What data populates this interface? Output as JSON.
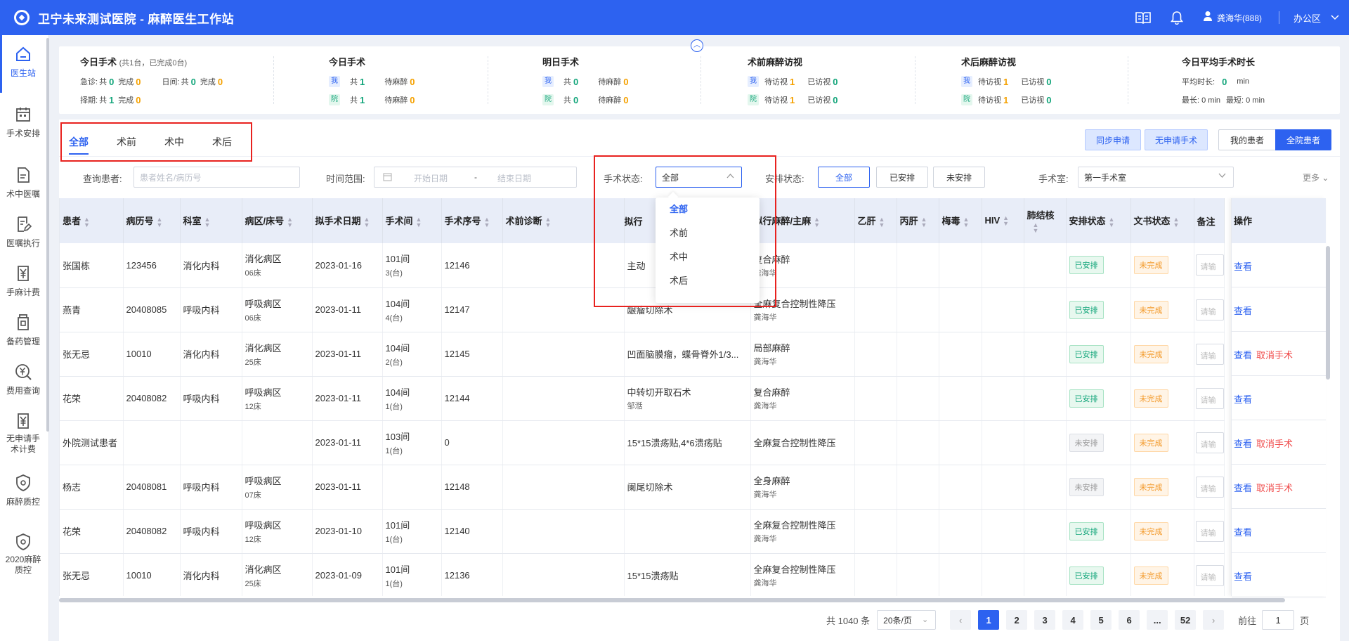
{
  "app": {
    "title": "卫宁未来测试医院 - 麻醉医生工作站"
  },
  "topbar": {
    "user": "龚海华(888)",
    "office": "办公区",
    "icons": [
      "book-icon",
      "bell-icon",
      "user-icon"
    ]
  },
  "sidebar": {
    "items": [
      {
        "label": "医生站",
        "icon": "home-icon",
        "glyph": "⌂"
      },
      {
        "label": "手术安排",
        "icon": "calendar-icon",
        "glyph": "▦"
      },
      {
        "label": "术中医嘱",
        "icon": "document-icon",
        "glyph": "▤"
      },
      {
        "label": "医嘱执行",
        "icon": "edit-document-icon",
        "glyph": "✎"
      },
      {
        "label": "手麻计费",
        "icon": "yen-icon",
        "glyph": "¥"
      },
      {
        "label": "备药管理",
        "icon": "medicine-icon",
        "glyph": "⚱"
      },
      {
        "label": "费用查询",
        "icon": "yen-search-icon",
        "glyph": "¥"
      },
      {
        "label": "无申请手术计费",
        "icon": "yen-document-icon",
        "glyph": "¥"
      },
      {
        "label": "麻醉质控",
        "icon": "shield-icon",
        "glyph": "⛉"
      },
      {
        "label": "2020麻醉质控",
        "icon": "shield-icon",
        "glyph": "⛉"
      }
    ]
  },
  "stats": {
    "today_surgery": {
      "title": "今日手术",
      "sub": "(共1台，已完成0台)",
      "emergency_label": "急诊:",
      "total_label": "共",
      "done_label": "完成",
      "emergency_total": "0",
      "emergency_done": "0",
      "day_label": "日间:",
      "day_total": "0",
      "day_done": "0",
      "elective_label": "择期:",
      "elective_total": "1",
      "elective_done": "0"
    },
    "today_op": {
      "title": "今日手术",
      "me": "我",
      "yuan": "院",
      "total_label": "共",
      "pending_label": "待麻醉",
      "me_total": "1",
      "me_pending": "0",
      "yuan_total": "1",
      "yuan_pending": "0"
    },
    "tomorrow_op": {
      "title": "明日手术",
      "me": "我",
      "yuan": "院",
      "total_label": "共",
      "pending_label": "待麻醉",
      "me_total": "0",
      "me_pending": "0",
      "yuan_total": "0",
      "yuan_pending": "0"
    },
    "pre_visit": {
      "title": "术前麻醉访视",
      "me": "我",
      "yuan": "院",
      "pending_label": "待访视",
      "done_label": "已访视",
      "me_pending": "1",
      "me_done": "0",
      "yuan_pending": "1",
      "yuan_done": "0"
    },
    "post_visit": {
      "title": "术后麻醉访视",
      "me": "我",
      "yuan": "院",
      "pending_label": "待访视",
      "done_label": "已访视",
      "me_pending": "1",
      "me_done": "0",
      "yuan_pending": "1",
      "yuan_done": "0"
    },
    "avg_duration": {
      "title": "今日平均手术时长",
      "avg_label": "平均时长:",
      "avg_value": "0",
      "unit": "min",
      "max_label": "最长: 0 min",
      "min_label": "最短: 0 min"
    }
  },
  "tabs": [
    "全部",
    "术前",
    "术中",
    "术后"
  ],
  "buttons": {
    "sync": "同步申请",
    "no_apply": "无申请手术",
    "my_patients": "我的患者",
    "all_patients": "全院患者"
  },
  "filters": {
    "query_label": "查询患者:",
    "query_placeholder": "患者姓名/病历号",
    "time_label": "时间范围:",
    "start_placeholder": "开始日期",
    "range_sep": "-",
    "end_placeholder": "结束日期",
    "status_label": "手术状态:",
    "status_value": "全部",
    "arrange_label": "安排状态:",
    "arrange_options": [
      "全部",
      "已安排",
      "未安排"
    ],
    "room_label": "手术室:",
    "room_value": "第一手术室",
    "more": "更多"
  },
  "dropdown": {
    "options": [
      "全部",
      "术前",
      "术中",
      "术后"
    ]
  },
  "table": {
    "columns": [
      "患者",
      "病历号",
      "科室",
      "病区/床号",
      "拟手术日期",
      "手术间",
      "手术序号",
      "术前诊断",
      "拟行",
      "拟行麻醉/主麻",
      "乙肝",
      "丙肝",
      "梅毒",
      "HIV",
      "肺结核",
      "安排状态",
      "文书状态",
      "备注",
      "操作"
    ],
    "remark_placeholder": "请输",
    "view_label": "查看",
    "cancel_label": "取消手术",
    "rows": [
      {
        "name": "张国栋",
        "record": "123456",
        "dept": "消化内科",
        "ward": "消化病区",
        "bed": "06床",
        "date": "2023-01-16",
        "room": "101间",
        "room_sub": "3(台)",
        "seq": "12146",
        "diag": "",
        "op": "主动",
        "op_sub": "",
        "anes": "复合麻醉",
        "anes_doc": "龚海华",
        "arrange": "已安排",
        "doc_status": "未完成",
        "cancel": false
      },
      {
        "name": "燕青",
        "record": "20408085",
        "dept": "呼吸内科",
        "ward": "呼吸病区",
        "bed": "06床",
        "date": "2023-01-11",
        "room": "104间",
        "room_sub": "4(台)",
        "seq": "12147",
        "diag": "",
        "op": "龈瘤切除术",
        "op_sub": "",
        "anes": "全麻复合控制性降压",
        "anes_doc": "龚海华",
        "arrange": "已安排",
        "doc_status": "未完成",
        "cancel": false
      },
      {
        "name": "张无忌",
        "record": "10010",
        "dept": "消化内科",
        "ward": "消化病区",
        "bed": "25床",
        "date": "2023-01-11",
        "room": "104间",
        "room_sub": "2(台)",
        "seq": "12145",
        "diag": "",
        "op": "凹面脑膜瘤，蝶骨脊外1/3...",
        "op_sub": "",
        "anes": "局部麻醉",
        "anes_doc": "龚海华",
        "arrange": "已安排",
        "doc_status": "未完成",
        "cancel": true
      },
      {
        "name": "花荣",
        "record": "20408082",
        "dept": "呼吸内科",
        "ward": "呼吸病区",
        "bed": "12床",
        "date": "2023-01-11",
        "room": "104间",
        "room_sub": "1(台)",
        "seq": "12144",
        "diag": "",
        "op": "中转切开取石术",
        "op_sub": "邹湉",
        "anes": "复合麻醉",
        "anes_doc": "龚海华",
        "arrange": "已安排",
        "doc_status": "未完成",
        "cancel": false
      },
      {
        "name": "外院测试患者",
        "record": "",
        "dept": "",
        "ward": "",
        "bed": "",
        "date": "2023-01-11",
        "room": "103间",
        "room_sub": "1(台)",
        "seq": "0",
        "diag": "",
        "op": "15*15溃疡贴,4*6溃疡贴",
        "op_sub": "",
        "anes": "全麻复合控制性降压",
        "anes_doc": "",
        "arrange": "未安排",
        "doc_status": "未完成",
        "cancel": true
      },
      {
        "name": "杨志",
        "record": "20408081",
        "dept": "呼吸内科",
        "ward": "呼吸病区",
        "bed": "07床",
        "date": "2023-01-11",
        "room": "",
        "room_sub": "",
        "seq": "12148",
        "diag": "",
        "op": "阑尾切除术",
        "op_sub": "",
        "anes": "全身麻醉",
        "anes_doc": "龚海华",
        "arrange": "未安排",
        "doc_status": "未完成",
        "cancel": true
      },
      {
        "name": "花荣",
        "record": "20408082",
        "dept": "呼吸内科",
        "ward": "呼吸病区",
        "bed": "12床",
        "date": "2023-01-10",
        "room": "101间",
        "room_sub": "1(台)",
        "seq": "12140",
        "diag": "",
        "op": "",
        "op_sub": "",
        "anes": "全麻复合控制性降压",
        "anes_doc": "龚海华",
        "arrange": "已安排",
        "doc_status": "未完成",
        "cancel": false
      },
      {
        "name": "张无忌",
        "record": "10010",
        "dept": "消化内科",
        "ward": "消化病区",
        "bed": "25床",
        "date": "2023-01-09",
        "room": "101间",
        "room_sub": "1(台)",
        "seq": "12136",
        "diag": "",
        "op": "15*15溃疡贴",
        "op_sub": "",
        "anes": "全麻复合控制性降压",
        "anes_doc": "龚海华",
        "arrange": "已安排",
        "doc_status": "未完成",
        "cancel": false
      }
    ]
  },
  "pagination": {
    "total": "共 1040 条",
    "page_size": "20条/页",
    "pages": [
      "1",
      "2",
      "3",
      "4",
      "5",
      "6",
      "...",
      "52"
    ],
    "current": "1",
    "goto_label": "前往",
    "goto_value": "1",
    "page_suffix": "页",
    "prev": "‹",
    "next": "›"
  },
  "colors": {
    "primary": "#2d62f0",
    "green": "#12a57a",
    "orange": "#f5a100",
    "red": "#e8221f"
  }
}
